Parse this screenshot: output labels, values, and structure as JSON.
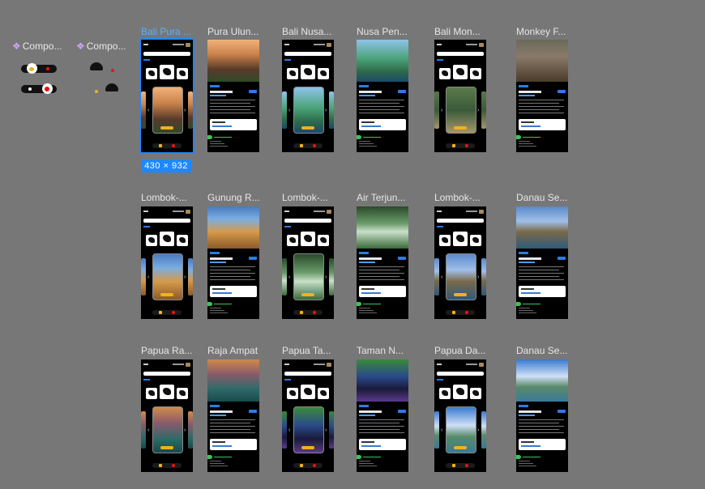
{
  "components": [
    {
      "label": "Compo..."
    },
    {
      "label": "Compo..."
    }
  ],
  "selected_size": "430 × 932",
  "colors": {
    "canvas": "#777777",
    "frame": "#000000",
    "accent_blue": "#2b7de0",
    "accent_yellow": "#f2b01e",
    "accent_red": "#e11111",
    "accent_green": "#39c45a",
    "selection": "#1e88ff"
  },
  "rows": [
    {
      "frames": [
        {
          "label": "Bali Pura ...",
          "type": "map",
          "selected": true,
          "card": "bali"
        },
        {
          "label": "Pura Ulun...",
          "type": "detail",
          "photo": "bali"
        },
        {
          "label": "Bali Nusa...",
          "type": "map",
          "card": "coast"
        },
        {
          "label": "Nusa Pen...",
          "type": "detail",
          "photo": "coast"
        },
        {
          "label": "Bali Mon...",
          "type": "map",
          "card": "forest"
        },
        {
          "label": "Monkey F...",
          "type": "detail",
          "photo": "monkey"
        }
      ]
    },
    {
      "frames": [
        {
          "label": "Lombok-...",
          "type": "map",
          "card": "canyon"
        },
        {
          "label": "Gunung R...",
          "type": "detail",
          "photo": "canyon"
        },
        {
          "label": "Lombok-...",
          "type": "map",
          "card": "waterfall"
        },
        {
          "label": "Air Terjun...",
          "type": "detail",
          "photo": "waterfall"
        },
        {
          "label": "Lombok-...",
          "type": "map",
          "card": "lake"
        },
        {
          "label": "Danau Se...",
          "type": "detail",
          "photo": "lake"
        }
      ]
    },
    {
      "frames": [
        {
          "label": "Papua Ra...",
          "type": "map",
          "card": "raja"
        },
        {
          "label": "Raja Ampat",
          "type": "detail",
          "photo": "raja"
        },
        {
          "label": "Papua Ta...",
          "type": "map",
          "card": "bird"
        },
        {
          "label": "Taman N...",
          "type": "detail",
          "photo": "bird"
        },
        {
          "label": "Papua Da...",
          "type": "map",
          "card": "sky"
        },
        {
          "label": "Danau Se...",
          "type": "detail",
          "photo": "sky"
        }
      ]
    }
  ]
}
